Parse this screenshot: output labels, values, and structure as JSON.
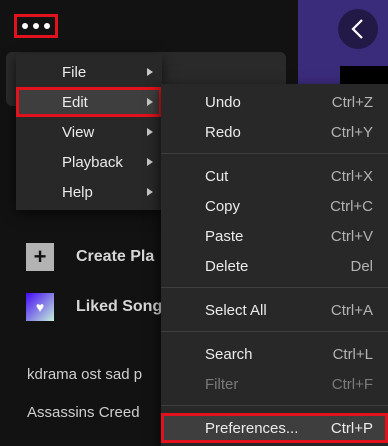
{
  "colors": {
    "background": "#121212",
    "menu_bg": "#282828",
    "highlight_red": "#e1121b",
    "hero_purple": "#3b2b7b"
  },
  "header": {
    "more_icon": "ellipsis-icon",
    "back_icon": "chevron-left-icon"
  },
  "sidebar": {
    "create_playlist": "Create Pla",
    "liked_songs": "Liked Song",
    "playlists": [
      "kdrama ost sad p",
      "Assassins Creed"
    ]
  },
  "menu": {
    "items": [
      {
        "label": "File",
        "has_submenu": true
      },
      {
        "label": "Edit",
        "has_submenu": true,
        "active": true
      },
      {
        "label": "View",
        "has_submenu": true
      },
      {
        "label": "Playback",
        "has_submenu": true
      },
      {
        "label": "Help",
        "has_submenu": true
      }
    ]
  },
  "edit_menu": {
    "items": [
      {
        "label": "Undo",
        "shortcut": "Ctrl+Z"
      },
      {
        "label": "Redo",
        "shortcut": "Ctrl+Y"
      },
      {
        "label": "Cut",
        "shortcut": "Ctrl+X"
      },
      {
        "label": "Copy",
        "shortcut": "Ctrl+C"
      },
      {
        "label": "Paste",
        "shortcut": "Ctrl+V"
      },
      {
        "label": "Delete",
        "shortcut": "Del"
      },
      {
        "label": "Select All",
        "shortcut": "Ctrl+A"
      },
      {
        "label": "Search",
        "shortcut": "Ctrl+L"
      },
      {
        "label": "Filter",
        "shortcut": "Ctrl+F",
        "disabled": true
      },
      {
        "label": "Preferences...",
        "shortcut": "Ctrl+P",
        "active": true
      }
    ]
  }
}
